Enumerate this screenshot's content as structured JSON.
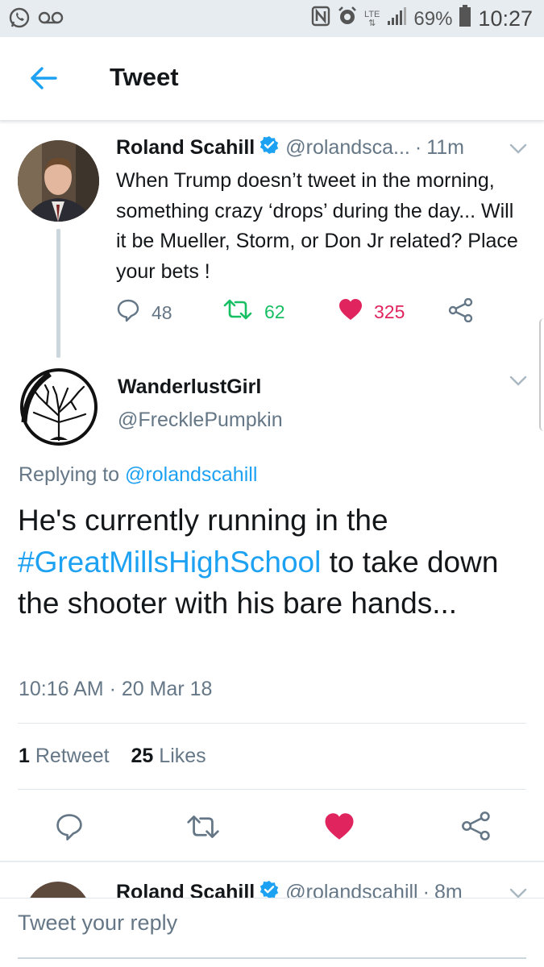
{
  "status_bar": {
    "battery_percent": "69%",
    "time": "10:27",
    "network": "LTE"
  },
  "header": {
    "title": "Tweet"
  },
  "parent_tweet": {
    "name": "Roland Scahill",
    "handle": "@rolandsca...",
    "time": "11m",
    "text": "When Trump doesn’t tweet in the morning, something crazy ‘drops’ during the day... Will it be Mueller, Storm, or Don Jr related? Place your bets !",
    "replies": "48",
    "retweets": "62",
    "likes": "325"
  },
  "focused_tweet": {
    "name": "WanderlustGirl",
    "handle": "@FrecklePumpkin",
    "replying_prefix": "Replying to",
    "replying_to": "@rolandscahill",
    "text_before": "He's currently running in the ",
    "hashtag": "#GreatMillsHighSchool",
    "text_after": " to take down the shooter with his bare hands...",
    "timestamp": "10:16 AM · 20 Mar 18",
    "retweet_count": "1",
    "retweet_label": "Retweet",
    "like_count": "25",
    "like_label": "Likes"
  },
  "next_tweet": {
    "name": "Roland Scahill",
    "handle": "@rolandscahill",
    "time": "8m"
  },
  "composer": {
    "placeholder": "Tweet your reply"
  },
  "colors": {
    "accent": "#1da1f2",
    "retweet_green": "#17bf63",
    "like_red": "#e0245e",
    "secondary_text": "#657786"
  },
  "icons": [
    "whatsapp-icon",
    "voicemail-icon",
    "nfc-icon",
    "alarm-icon",
    "signal-icon",
    "battery-icon",
    "back-arrow-icon",
    "verified-badge-icon",
    "chevron-down-icon",
    "reply-icon",
    "retweet-icon",
    "heart-icon",
    "share-icon"
  ]
}
